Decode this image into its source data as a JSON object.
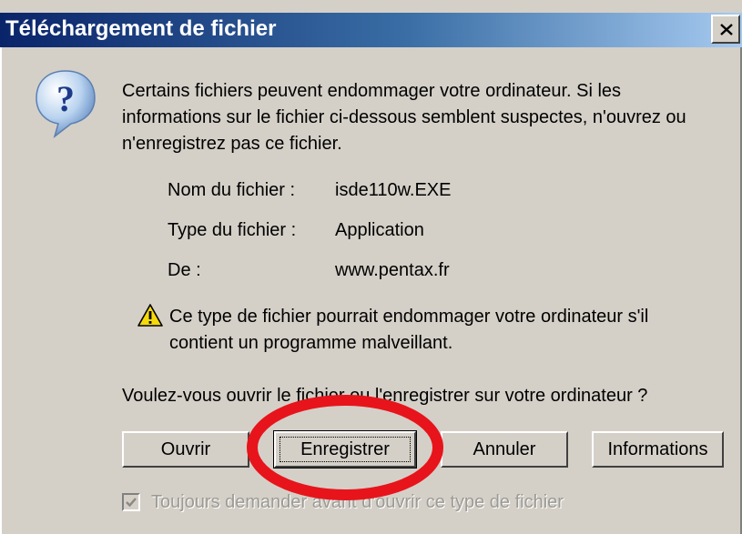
{
  "window": {
    "title": "Téléchargement de fichier"
  },
  "message": "Certains fichiers peuvent endommager votre ordinateur. Si les informations sur le fichier ci-dessous semblent suspectes, n'ouvrez ou n'enregistrez pas ce fichier.",
  "file_info": {
    "name_label": "Nom du fichier :",
    "name_value": "isde110w.EXE",
    "type_label": "Type du fichier :",
    "type_value": "Application",
    "from_label": "De :",
    "from_value": "www.pentax.fr"
  },
  "warning": "Ce type de fichier pourrait endommager votre ordinateur s'il contient un programme malveillant.",
  "question": "Voulez-vous ouvrir le fichier ou l'enregistrer sur votre ordinateur ?",
  "buttons": {
    "open": "Ouvrir",
    "save": "Enregistrer",
    "cancel": "Annuler",
    "info": "Informations"
  },
  "checkbox": {
    "label": "Toujours demander avant d'ouvrir ce type de fichier",
    "checked": true
  },
  "colors": {
    "titlebar": "#0a246a",
    "dialog_bg": "#d4d0c8",
    "annotation": "#e8141b"
  },
  "icons": [
    "question-icon",
    "warning-icon",
    "close-icon",
    "checkmark-icon"
  ]
}
